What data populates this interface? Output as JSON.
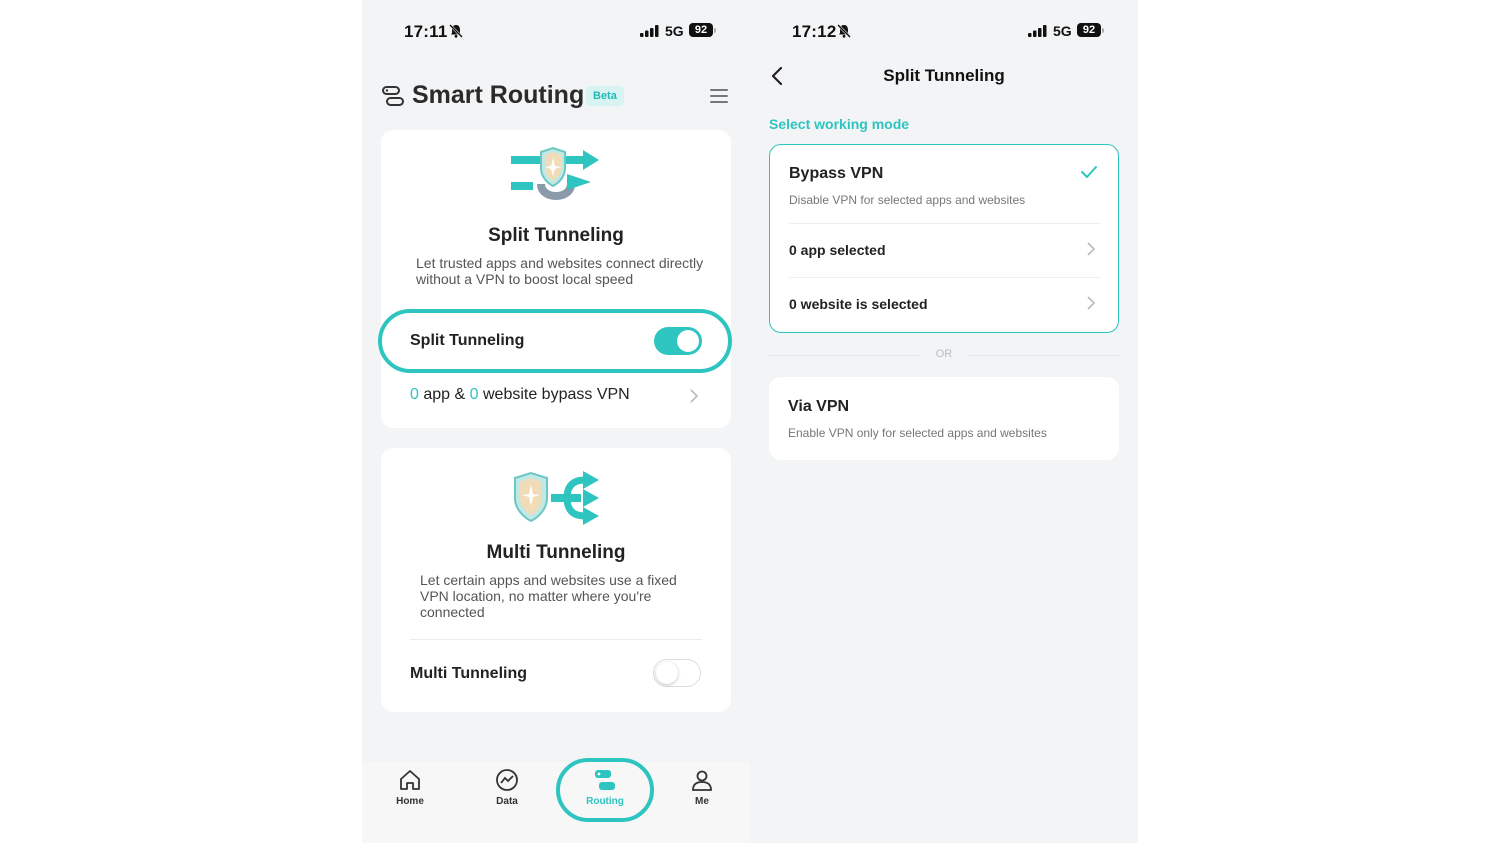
{
  "left_screen": {
    "status": {
      "time": "17:11",
      "network": "5G",
      "battery": "92"
    },
    "header": {
      "title": "Smart Routing",
      "badge": "Beta"
    },
    "split_card": {
      "title": "Split Tunneling",
      "description": "Let trusted apps and websites connect directly without a VPN to boost local speed",
      "toggle_label": "Split Tunneling",
      "toggle_on": true,
      "summary": {
        "app_count": "0",
        "app_text": "app &",
        "website_count": "0",
        "website_text": "website bypass VPN"
      }
    },
    "multi_card": {
      "title": "Multi Tunneling",
      "description": "Let certain apps and websites use a fixed VPN location, no matter where you're connected",
      "toggle_label": "Multi Tunneling",
      "toggle_on": false
    },
    "nav": [
      {
        "label": "Home",
        "icon": "home-icon"
      },
      {
        "label": "Data",
        "icon": "chart-icon"
      },
      {
        "label": "Routing",
        "icon": "routing-icon",
        "active": true
      },
      {
        "label": "Me",
        "icon": "person-icon"
      }
    ]
  },
  "right_screen": {
    "status": {
      "time": "17:12",
      "network": "5G",
      "battery": "92"
    },
    "header": {
      "title": "Split Tunneling"
    },
    "section_label": "Select working mode",
    "bypass": {
      "title": "Bypass VPN",
      "description": "Disable VPN for selected apps and websites",
      "apps_row": "0 app selected",
      "websites_row": "0 website is selected"
    },
    "or_label": "OR",
    "via": {
      "title": "Via VPN",
      "description": "Enable VPN only for selected apps and websites"
    }
  },
  "colors": {
    "accent": "#2ec4c0",
    "background": "#f3f4f5",
    "card": "#ffffff"
  }
}
